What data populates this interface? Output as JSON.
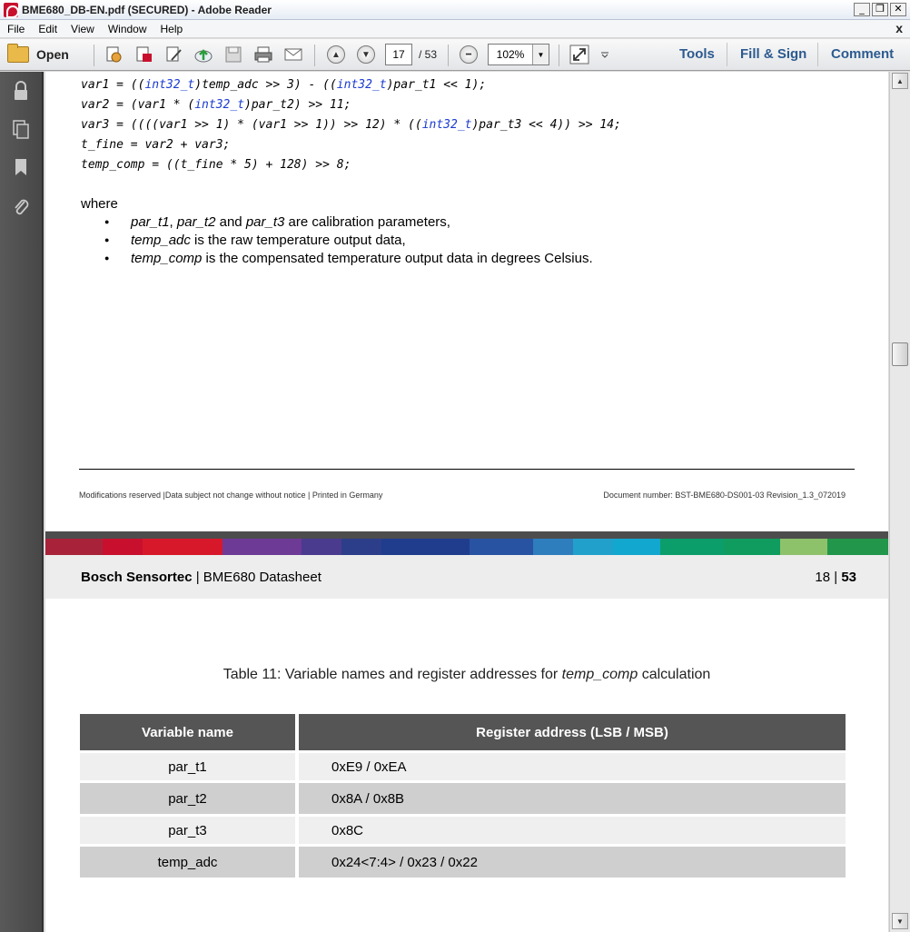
{
  "window": {
    "title": "BME680_DB-EN.pdf (SECURED) - Adobe Reader"
  },
  "window_buttons": {
    "minimize": "_",
    "restore": "❐",
    "close": "✕"
  },
  "menu": {
    "items": [
      "File",
      "Edit",
      "View",
      "Window",
      "Help"
    ],
    "close_glyph": "x"
  },
  "toolbar": {
    "open_label": "Open",
    "page_current": "17",
    "page_total": "/ 53",
    "zoom": "102%",
    "right_tabs": [
      "Tools",
      "Fill & Sign",
      "Comment"
    ]
  },
  "page1": {
    "code": [
      [
        "var1 = ((",
        "int32_t",
        ")temp_adc >> 3) - ((",
        "int32_t",
        ")par_t1 << 1);"
      ],
      [
        "var2 = (var1 * (",
        "int32_t",
        ")par_t2) >> 11;"
      ],
      [
        "var3 = ((((var1 >> 1) * (var1 >> 1)) >> 12) * ((",
        "int32_t",
        ")par_t3 << 4)) >> 14;"
      ],
      [
        "t_fine = var2 + var3;"
      ],
      [
        "temp_comp = ((t_fine * 5) + 128) >> 8;"
      ]
    ],
    "where": "where",
    "bullets": [
      {
        "it1": "par_t1",
        "sep1": ", ",
        "it2": "par_t2",
        "sep2": " and ",
        "it3": "par_t3",
        "rest": " are calibration parameters,"
      },
      {
        "it1": "temp_adc",
        "rest": " is the raw temperature output data,"
      },
      {
        "it1": "temp_comp",
        "rest": " is the compensated temperature output data in degrees Celsius."
      }
    ],
    "footer_left": "Modifications reserved |Data subject not change without notice | Printed in Germany",
    "footer_right": "Document number: BST-BME680-DS001-03 Revision_1.3_072019"
  },
  "page2": {
    "brand_bold": "Bosch Sensortec",
    "brand_rest": " | BME680 Datasheet",
    "page_label": "18 | ",
    "page_total": "53",
    "caption_pre": "Table 11: Variable names and register addresses for ",
    "caption_it": "temp_comp",
    "caption_post": " calculation",
    "table": {
      "headers": [
        "Variable name",
        "Register address (LSB / MSB)"
      ],
      "rows": [
        [
          "par_t1",
          "0xE9 / 0xEA"
        ],
        [
          "par_t2",
          "0x8A / 0x8B"
        ],
        [
          "par_t3",
          "0x8C"
        ],
        [
          "temp_adc",
          "0x24<7:4> / 0x23 / 0x22"
        ]
      ]
    },
    "stripe_colors": [
      "#a8233a",
      "#c8102e",
      "#d7182a",
      "#6d3a96",
      "#4a3b8f",
      "#2c3e8a",
      "#203d8d",
      "#2753a2",
      "#2e7dbd",
      "#22a0cc",
      "#12a7cf",
      "#0b9e6a",
      "#109c5e",
      "#8dc26b",
      "#22964a"
    ]
  },
  "colors": {
    "keyword": "#1a3bd1",
    "tab_text": "#2c5a8f",
    "table_header": "#555555"
  }
}
